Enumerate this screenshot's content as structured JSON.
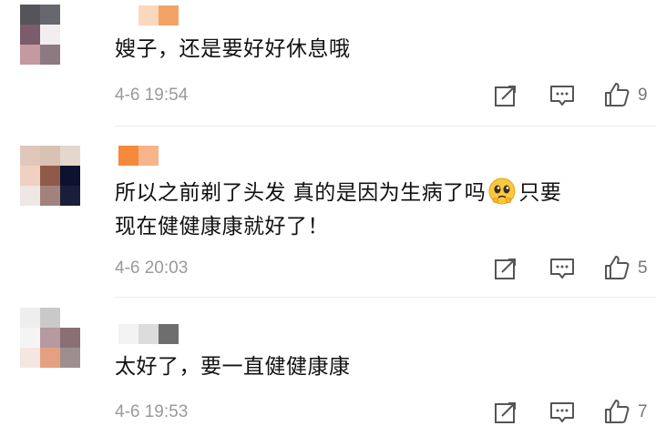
{
  "comments": [
    {
      "text": "嫂子，还是要好好休息哦",
      "time": "4-6 19:54",
      "likes": "9",
      "avatar_colors": [
        "#55545b",
        "#67676f",
        "#ffffff",
        "#7a5c6a",
        "#f2eef0",
        "#ffffff",
        "#c49aa0",
        "#8d7a80",
        "#ffffff"
      ],
      "name_colors": [
        "#ffffff",
        "#fbd7bd",
        "#f2a365"
      ]
    },
    {
      "text_line1_before_emoji": "所以之前剃了头发 真的是因为生病了吗",
      "emoji": "pleading-face-emoji",
      "text_line1_after_emoji": "只要",
      "text_line2": "现在健健康康就好了！",
      "time": "4-6 20:03",
      "likes": "5",
      "avatar_colors": [
        "#e0c7b9",
        "#d8c2b4",
        "#e6d7cc",
        "#f0d0c0",
        "#8f5a4a",
        "#0d1230",
        "#efe7e3",
        "#a1837b",
        "#1b1e3a"
      ],
      "name_colors": [
        "#f58a3a",
        "#f7b48a",
        "#ffffff"
      ]
    },
    {
      "text": "太好了，要一直健健康康",
      "time": "4-6 19:53",
      "likes": "7",
      "avatar_colors": [
        "#eeeeee",
        "#c9c9c9",
        "#ffffff",
        "#f4f4f4",
        "#b59aa0",
        "#8a6f75",
        "#f4e7e1",
        "#e3a181",
        "#9e8e8e"
      ],
      "name_colors": [
        "#f3f3f3",
        "#dcdcdc",
        "#6e6e6e"
      ]
    }
  ],
  "icons": {
    "repost": "repost-icon",
    "reply": "comment-icon",
    "like": "thumbs-up-icon"
  }
}
